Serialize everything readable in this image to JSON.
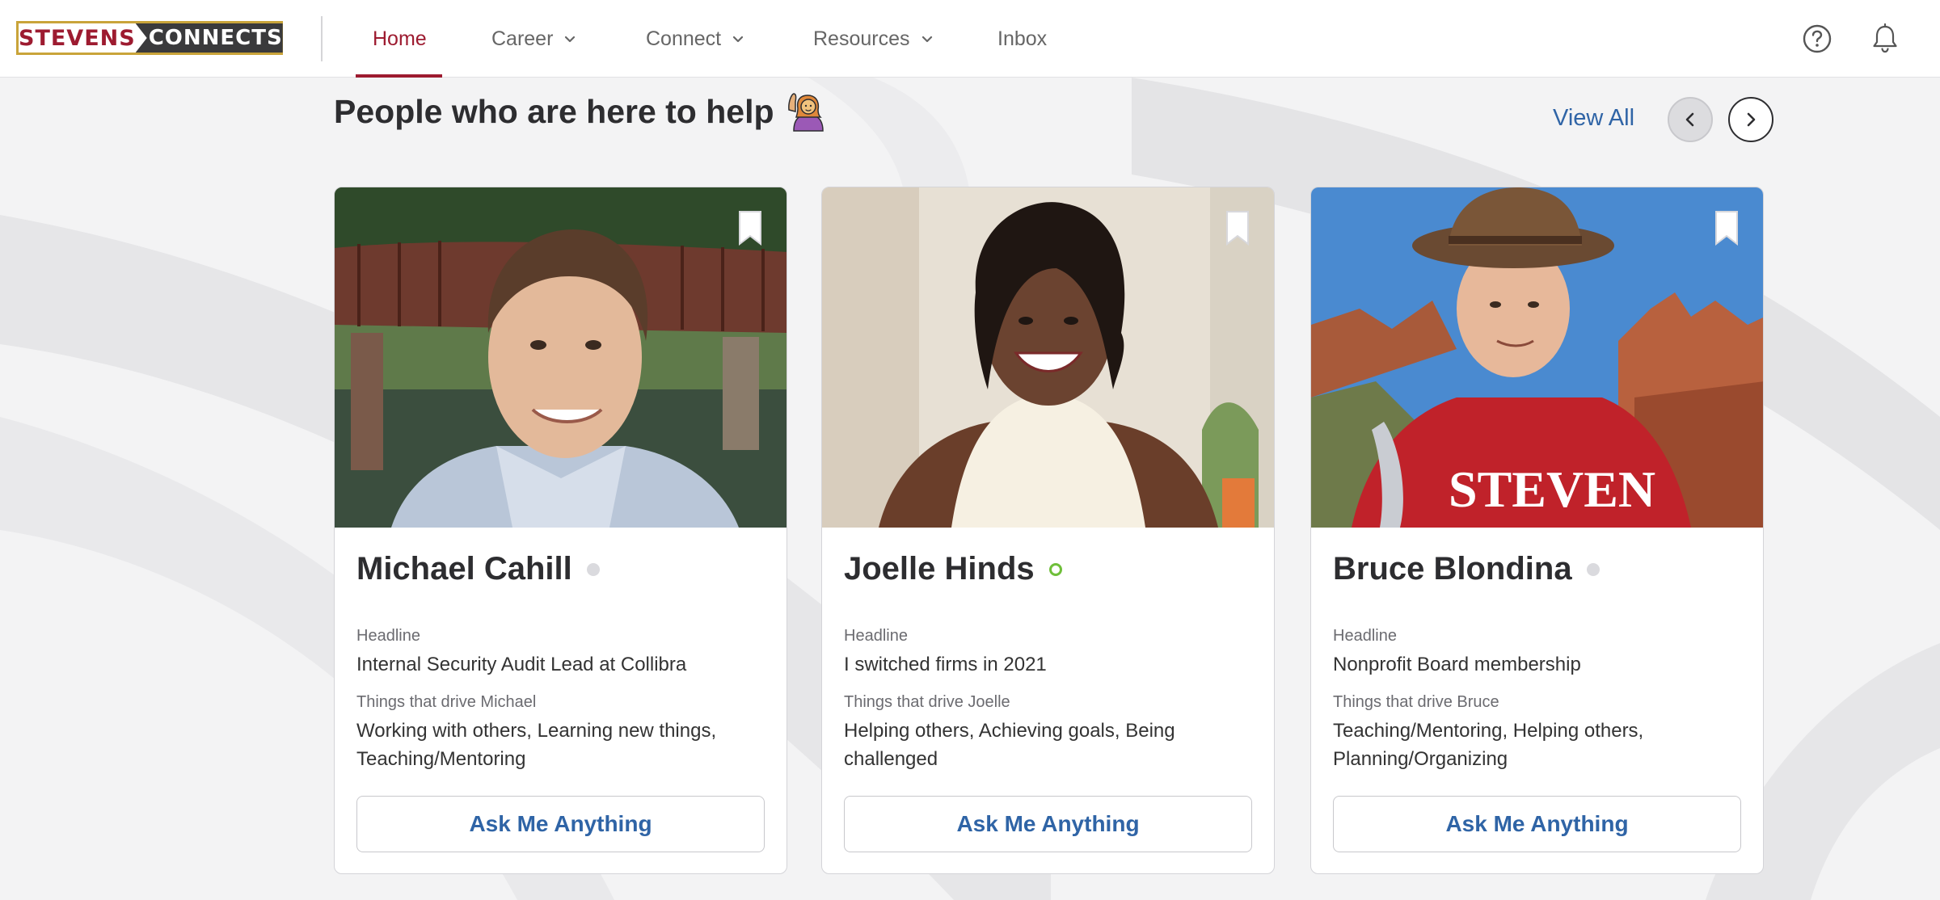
{
  "brand": {
    "logo_left": "STEVENS",
    "logo_right": "CONNECTS"
  },
  "nav": {
    "items": [
      {
        "label": "Home",
        "active": true
      },
      {
        "label": "Career",
        "dropdown": true
      },
      {
        "label": "Connect",
        "dropdown": true
      },
      {
        "label": "Resources",
        "dropdown": true
      },
      {
        "label": "Inbox"
      }
    ],
    "icons": [
      "help-icon",
      "bell-icon"
    ]
  },
  "section": {
    "title": "People who are here to help",
    "view_all": "View All"
  },
  "cards": [
    {
      "name": "Michael Cahill",
      "status": "offline",
      "headline_label": "Headline",
      "headline": "Internal Security Audit Lead at Collibra",
      "drive_label": "Things that drive Michael",
      "drives": "Working with others, Learning new things, Teaching/Mentoring",
      "button": "Ask Me Anything"
    },
    {
      "name": "Joelle Hinds",
      "status": "online",
      "headline_label": "Headline",
      "headline": "I switched firms in 2021",
      "drive_label": "Things that drive Joelle",
      "drives": "Helping others, Achieving goals, Being challenged",
      "button": "Ask Me Anything"
    },
    {
      "name": "Bruce Blondina",
      "status": "offline",
      "headline_label": "Headline",
      "headline": "Nonprofit Board membership",
      "drive_label": "Things that drive Bruce",
      "drives": "Teaching/Mentoring, Helping others, Planning/Organizing",
      "button": "Ask Me Anything"
    }
  ],
  "colors": {
    "brand_red": "#9d1b30",
    "brand_gold": "#c9a43a",
    "link_blue": "#2f64a6",
    "online_green": "#6fbf3a"
  }
}
